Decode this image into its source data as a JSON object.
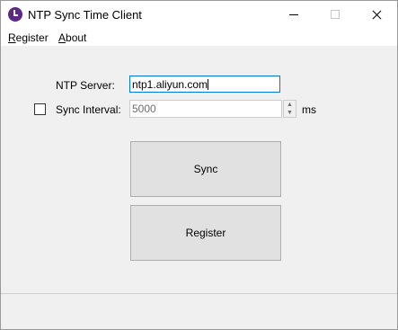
{
  "window": {
    "title": "NTP Sync Time Client",
    "accent": "#5b2a86"
  },
  "menu": {
    "register": {
      "accel": "R",
      "rest": "egister"
    },
    "about": {
      "accel": "A",
      "rest": "bout"
    }
  },
  "form": {
    "server_label": "NTP Server:",
    "server_value": "ntp1.aliyun.com",
    "interval_label": "Sync Interval:",
    "interval_value": "5000",
    "interval_enabled": false,
    "interval_unit": "ms"
  },
  "buttons": {
    "sync": "Sync",
    "register": "Register"
  }
}
